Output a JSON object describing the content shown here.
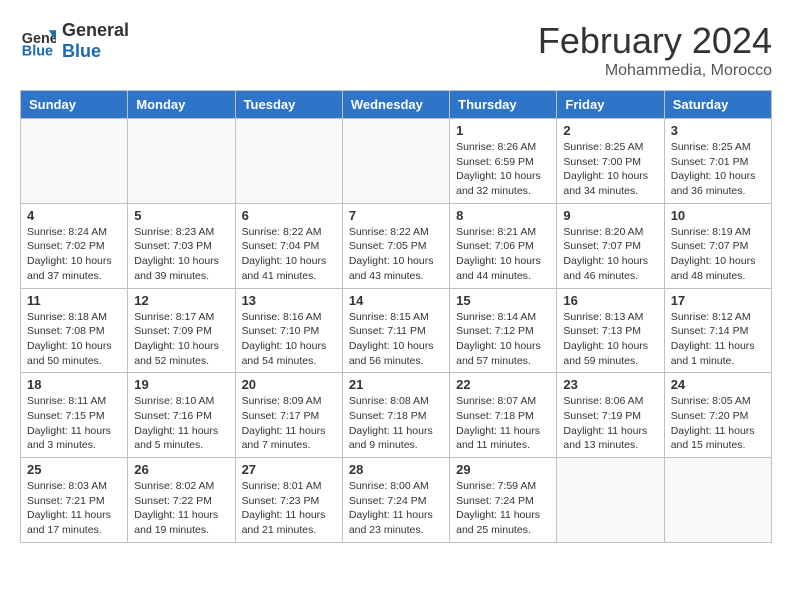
{
  "logo": {
    "line1": "General",
    "line2": "Blue"
  },
  "title": "February 2024",
  "subtitle": "Mohammedia, Morocco",
  "days_header": [
    "Sunday",
    "Monday",
    "Tuesday",
    "Wednesday",
    "Thursday",
    "Friday",
    "Saturday"
  ],
  "weeks": [
    [
      {
        "day": "",
        "info": ""
      },
      {
        "day": "",
        "info": ""
      },
      {
        "day": "",
        "info": ""
      },
      {
        "day": "",
        "info": ""
      },
      {
        "day": "1",
        "info": "Sunrise: 8:26 AM\nSunset: 6:59 PM\nDaylight: 10 hours\nand 32 minutes."
      },
      {
        "day": "2",
        "info": "Sunrise: 8:25 AM\nSunset: 7:00 PM\nDaylight: 10 hours\nand 34 minutes."
      },
      {
        "day": "3",
        "info": "Sunrise: 8:25 AM\nSunset: 7:01 PM\nDaylight: 10 hours\nand 36 minutes."
      }
    ],
    [
      {
        "day": "4",
        "info": "Sunrise: 8:24 AM\nSunset: 7:02 PM\nDaylight: 10 hours\nand 37 minutes."
      },
      {
        "day": "5",
        "info": "Sunrise: 8:23 AM\nSunset: 7:03 PM\nDaylight: 10 hours\nand 39 minutes."
      },
      {
        "day": "6",
        "info": "Sunrise: 8:22 AM\nSunset: 7:04 PM\nDaylight: 10 hours\nand 41 minutes."
      },
      {
        "day": "7",
        "info": "Sunrise: 8:22 AM\nSunset: 7:05 PM\nDaylight: 10 hours\nand 43 minutes."
      },
      {
        "day": "8",
        "info": "Sunrise: 8:21 AM\nSunset: 7:06 PM\nDaylight: 10 hours\nand 44 minutes."
      },
      {
        "day": "9",
        "info": "Sunrise: 8:20 AM\nSunset: 7:07 PM\nDaylight: 10 hours\nand 46 minutes."
      },
      {
        "day": "10",
        "info": "Sunrise: 8:19 AM\nSunset: 7:07 PM\nDaylight: 10 hours\nand 48 minutes."
      }
    ],
    [
      {
        "day": "11",
        "info": "Sunrise: 8:18 AM\nSunset: 7:08 PM\nDaylight: 10 hours\nand 50 minutes."
      },
      {
        "day": "12",
        "info": "Sunrise: 8:17 AM\nSunset: 7:09 PM\nDaylight: 10 hours\nand 52 minutes."
      },
      {
        "day": "13",
        "info": "Sunrise: 8:16 AM\nSunset: 7:10 PM\nDaylight: 10 hours\nand 54 minutes."
      },
      {
        "day": "14",
        "info": "Sunrise: 8:15 AM\nSunset: 7:11 PM\nDaylight: 10 hours\nand 56 minutes."
      },
      {
        "day": "15",
        "info": "Sunrise: 8:14 AM\nSunset: 7:12 PM\nDaylight: 10 hours\nand 57 minutes."
      },
      {
        "day": "16",
        "info": "Sunrise: 8:13 AM\nSunset: 7:13 PM\nDaylight: 10 hours\nand 59 minutes."
      },
      {
        "day": "17",
        "info": "Sunrise: 8:12 AM\nSunset: 7:14 PM\nDaylight: 11 hours\nand 1 minute."
      }
    ],
    [
      {
        "day": "18",
        "info": "Sunrise: 8:11 AM\nSunset: 7:15 PM\nDaylight: 11 hours\nand 3 minutes."
      },
      {
        "day": "19",
        "info": "Sunrise: 8:10 AM\nSunset: 7:16 PM\nDaylight: 11 hours\nand 5 minutes."
      },
      {
        "day": "20",
        "info": "Sunrise: 8:09 AM\nSunset: 7:17 PM\nDaylight: 11 hours\nand 7 minutes."
      },
      {
        "day": "21",
        "info": "Sunrise: 8:08 AM\nSunset: 7:18 PM\nDaylight: 11 hours\nand 9 minutes."
      },
      {
        "day": "22",
        "info": "Sunrise: 8:07 AM\nSunset: 7:18 PM\nDaylight: 11 hours\nand 11 minutes."
      },
      {
        "day": "23",
        "info": "Sunrise: 8:06 AM\nSunset: 7:19 PM\nDaylight: 11 hours\nand 13 minutes."
      },
      {
        "day": "24",
        "info": "Sunrise: 8:05 AM\nSunset: 7:20 PM\nDaylight: 11 hours\nand 15 minutes."
      }
    ],
    [
      {
        "day": "25",
        "info": "Sunrise: 8:03 AM\nSunset: 7:21 PM\nDaylight: 11 hours\nand 17 minutes."
      },
      {
        "day": "26",
        "info": "Sunrise: 8:02 AM\nSunset: 7:22 PM\nDaylight: 11 hours\nand 19 minutes."
      },
      {
        "day": "27",
        "info": "Sunrise: 8:01 AM\nSunset: 7:23 PM\nDaylight: 11 hours\nand 21 minutes."
      },
      {
        "day": "28",
        "info": "Sunrise: 8:00 AM\nSunset: 7:24 PM\nDaylight: 11 hours\nand 23 minutes."
      },
      {
        "day": "29",
        "info": "Sunrise: 7:59 AM\nSunset: 7:24 PM\nDaylight: 11 hours\nand 25 minutes."
      },
      {
        "day": "",
        "info": ""
      },
      {
        "day": "",
        "info": ""
      }
    ]
  ]
}
